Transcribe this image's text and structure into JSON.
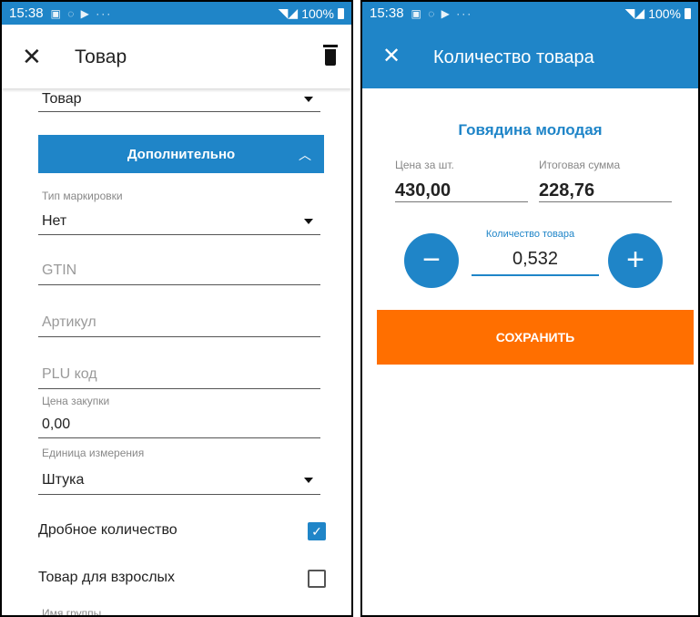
{
  "status": {
    "time": "15:38",
    "icons": "▣ ◌ ▶ ···",
    "battery": "100%"
  },
  "left": {
    "title": "Товар",
    "type_value": "Товар",
    "section_label": "Дополнительно",
    "marking": {
      "label": "Тип маркировки",
      "value": "Нет"
    },
    "gtin_placeholder": "GTIN",
    "article_placeholder": "Артикул",
    "plu_placeholder": "PLU код",
    "purchase": {
      "label": "Цена закупки",
      "value": "0,00"
    },
    "unit": {
      "label": "Единица измерения",
      "value": "Штука"
    },
    "fractional": {
      "label": "Дробное количество",
      "checked": true
    },
    "adult": {
      "label": "Товар для взрослых",
      "checked": false
    },
    "group_label": "Имя группы"
  },
  "right": {
    "title": "Количество товара",
    "product_name": "Говядина молодая",
    "price": {
      "label": "Цена за шт.",
      "value": "430,00"
    },
    "total": {
      "label": "Итоговая сумма",
      "value": "228,76"
    },
    "quantity": {
      "label": "Количество товара",
      "value": "0,532"
    },
    "save_label": "СОХРАНИТЬ"
  },
  "colors": {
    "primary": "#1f85c8",
    "accent": "#ff6f00"
  },
  "icons": {
    "close": "close-icon",
    "trash": "trash-icon",
    "dropdown": "dropdown-arrow-icon",
    "chevron": "chevron-up-icon",
    "minus": "minus-icon",
    "plus": "plus-icon",
    "check": "checkmark-icon"
  }
}
